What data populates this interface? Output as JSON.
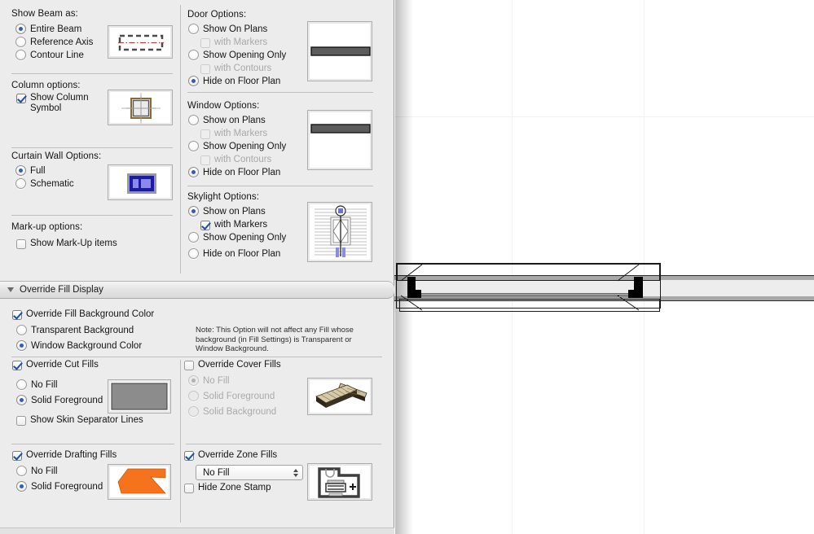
{
  "panel": {
    "beam": {
      "header": "Show Beam as:",
      "options": [
        {
          "label": "Entire Beam",
          "selected": true
        },
        {
          "label": "Reference Axis",
          "selected": false
        },
        {
          "label": "Contour Line",
          "selected": false
        }
      ],
      "preview_name": "beam-preview"
    },
    "column": {
      "header": "Column options:",
      "checkbox": {
        "label": "Show Column\nSymbol",
        "checked": true
      },
      "preview_name": "column-symbol-preview"
    },
    "curtain_wall": {
      "header": "Curtain Wall Options:",
      "options": [
        {
          "label": "Full",
          "selected": true
        },
        {
          "label": "Schematic",
          "selected": false
        }
      ],
      "preview_name": "curtain-wall-preview"
    },
    "markup": {
      "header": "Mark-up options:",
      "checkbox": {
        "label": "Show Mark-Up items",
        "checked": false
      }
    },
    "door": {
      "header": "Door Options:",
      "options": [
        {
          "label": "Show On Plans",
          "selected": false
        },
        {
          "label": "Show Opening Only",
          "selected": false
        },
        {
          "label": "Hide on Floor Plan",
          "selected": true
        }
      ],
      "sub_markers": {
        "label": "with Markers",
        "checked": false,
        "disabled": true
      },
      "sub_contours": {
        "label": "with Contours",
        "checked": false,
        "disabled": true
      },
      "preview_name": "door-preview"
    },
    "window": {
      "header": "Window Options:",
      "options": [
        {
          "label": "Show on Plans",
          "selected": false
        },
        {
          "label": "Show Opening Only",
          "selected": false
        },
        {
          "label": "Hide on Floor Plan",
          "selected": true
        }
      ],
      "sub_markers": {
        "label": "with Markers",
        "checked": false,
        "disabled": true
      },
      "sub_contours": {
        "label": "with Contours",
        "checked": false,
        "disabled": true
      },
      "preview_name": "window-preview"
    },
    "skylight": {
      "header": "Skylight Options:",
      "options": [
        {
          "label": "Show on Plans",
          "selected": true
        },
        {
          "label": "Show Opening Only",
          "selected": false
        },
        {
          "label": "Hide on Floor Plan",
          "selected": false
        }
      ],
      "sub_markers": {
        "label": "with Markers",
        "checked": true,
        "disabled": false
      },
      "preview_name": "skylight-preview"
    },
    "override_fill_display": {
      "title": "Override Fill Display",
      "expanded": true,
      "fill_background": {
        "checkbox": {
          "label": "Override Fill Background Color",
          "checked": true
        },
        "options": [
          {
            "label": "Transparent Background",
            "selected": false
          },
          {
            "label": "Window Background Color",
            "selected": true
          }
        ]
      },
      "note": "Note: This Option will not affect any Fill whose background (in Fill Settings) is Transparent or Window Background.",
      "cut_fills": {
        "checkbox": {
          "label": "Override Cut Fills",
          "checked": true
        },
        "options": [
          {
            "label": "No Fill",
            "selected": false
          },
          {
            "label": "Solid Foreground",
            "selected": true
          }
        ],
        "skin_separator": {
          "label": "Show Skin Separator Lines",
          "checked": false
        },
        "preview_name": "cut-fill-preview",
        "preview_color": "#8c8c8c"
      },
      "cover_fills": {
        "checkbox": {
          "label": "Override Cover Fills",
          "checked": false
        },
        "disabled": true,
        "options": [
          {
            "label": "No Fill",
            "selected": true
          },
          {
            "label": "Solid Foreground",
            "selected": false
          },
          {
            "label": "Solid Background",
            "selected": false
          }
        ],
        "preview_name": "cover-fill-preview"
      },
      "drafting_fills": {
        "checkbox": {
          "label": "Override Drafting Fills",
          "checked": true
        },
        "options": [
          {
            "label": "No Fill",
            "selected": false
          },
          {
            "label": "Solid Foreground",
            "selected": true
          }
        ],
        "preview_name": "drafting-fill-preview",
        "preview_color": "#f4731c"
      },
      "zone_fills": {
        "checkbox": {
          "label": "Override Zone Fills",
          "checked": true
        },
        "select_value": "No Fill",
        "hide_stamp": {
          "label": "Hide Zone Stamp",
          "checked": false
        },
        "preview_name": "zone-fill-preview"
      }
    }
  },
  "canvas": {
    "name": "floor-plan-canvas",
    "gridlines_v": [
      144,
      306
    ],
    "gridlines_h": [
      143
    ],
    "elements": [
      {
        "name": "wall-run",
        "type": "wall"
      },
      {
        "name": "window-opening-assembly",
        "type": "window"
      }
    ]
  },
  "colors": {
    "panel_bg": "#ececec",
    "accent_radio": "#2f5fb5",
    "accent_check": "#1b4fa8",
    "drafting_fill": "#f4731c",
    "cut_fill": "#8c8c8c",
    "curtain_wall": "#3b3bbe",
    "skylight_marker": "#6f6fe0"
  }
}
